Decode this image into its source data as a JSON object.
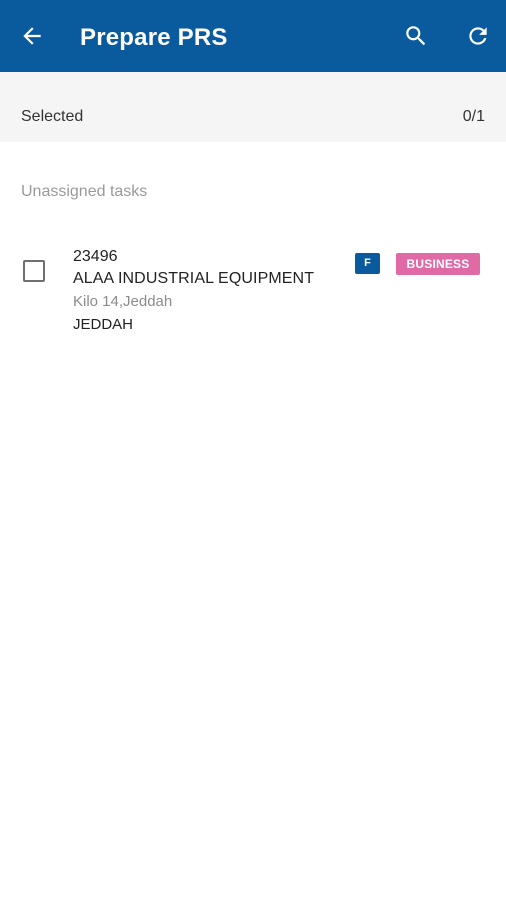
{
  "app_bar": {
    "title": "Prepare PRS",
    "background_color": "#0a5b9e",
    "icons": {
      "back": "arrow-back-icon",
      "search": "search-icon",
      "refresh": "refresh-icon"
    }
  },
  "selection": {
    "label": "Selected",
    "count": "0/1"
  },
  "unassigned_section": {
    "header": "Unassigned tasks",
    "tasks": [
      {
        "id": "23496",
        "customer": "ALAA INDUSTRIAL EQUIPMENT",
        "address": "Kilo 14,Jeddah",
        "city": "JEDDAH",
        "checked": false,
        "badges": [
          {
            "label": "F",
            "color": "#0a5b9e"
          },
          {
            "label": "BUSINESS",
            "color": "#e06aa6"
          }
        ]
      }
    ]
  }
}
